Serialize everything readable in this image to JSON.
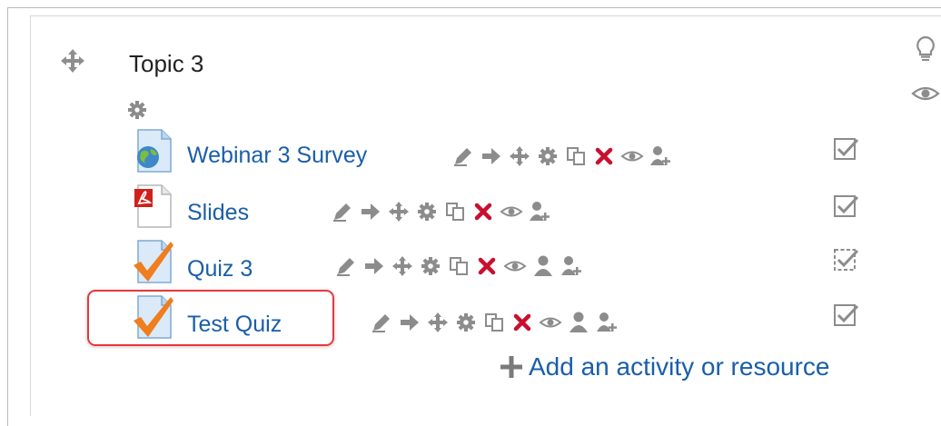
{
  "section": {
    "title": "Topic 3"
  },
  "activities": [
    {
      "name": "Webinar 3 Survey",
      "type_icon": "survey-globe-icon",
      "has_assign_roles": false
    },
    {
      "name": "Slides",
      "type_icon": "pdf-file-icon",
      "has_assign_roles": false
    },
    {
      "name": "Quiz 3",
      "type_icon": "quiz-checkmark-icon",
      "has_assign_roles": true
    },
    {
      "name": "Test Quiz",
      "type_icon": "quiz-checkmark-icon",
      "has_assign_roles": true
    }
  ],
  "add_activity": {
    "label": "Add an activity or resource"
  },
  "icons": {
    "edit": "pencil-icon",
    "move_right": "arrow-right-icon",
    "move": "move-cross-icon",
    "settings": "gear-icon",
    "duplicate": "duplicate-icon",
    "delete": "delete-x-icon",
    "hide": "eye-icon",
    "groups": "person-icon",
    "assign_roles": "assign-roles-icon",
    "completion": "checkbox-icon",
    "highlight": "lightbulb-icon",
    "show": "eye-icon"
  },
  "colors": {
    "link": "#1a5ea9",
    "delete": "#c8102e",
    "tool_gray": "#8c8c8c",
    "highlight_border": "#e2393f",
    "quiz_check": "#f07d1e"
  }
}
